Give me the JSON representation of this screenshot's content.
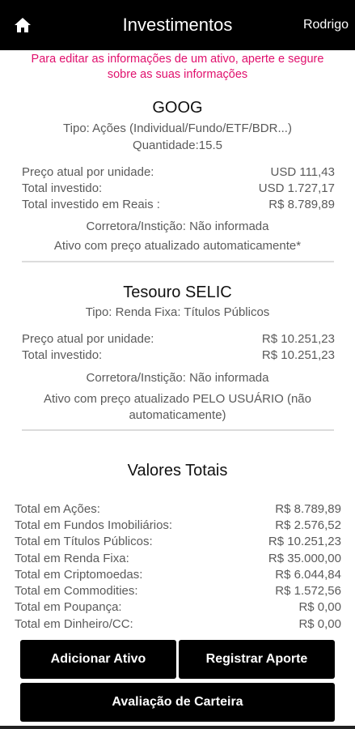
{
  "appbar": {
    "title": "Investimentos",
    "user": "Rodrigo",
    "home_icon": "home-icon"
  },
  "hint": {
    "line1": "Para editar as informações de um ativo, aperte e segure",
    "line2": "sobre as suas informações"
  },
  "assets": [
    {
      "name": "GOOG",
      "type": "Tipo: Ações (Individual/Fundo/ETF/BDR...)",
      "quantity": "Quantidade:15.5",
      "rows": [
        {
          "label": "Preço atual por unidade:",
          "value": "USD  111,43"
        },
        {
          "label": "Total investido:",
          "value": "USD  1.727,17"
        },
        {
          "label": "Total investido em Reais :",
          "value": "R$  8.789,89"
        }
      ],
      "broker": "Corretora/Instição: Não informada",
      "price_mode": "Ativo com preço atualizado automaticamente*"
    },
    {
      "name": "Tesouro SELIC",
      "type": "Tipo: Renda Fixa: Títulos Públicos",
      "rows": [
        {
          "label": "Preço atual por unidade:",
          "value": "R$  10.251,23"
        },
        {
          "label": "Total investido:",
          "value": "R$  10.251,23"
        }
      ],
      "broker": "Corretora/Instição: Não informada",
      "price_mode_line1": "Ativo com preço atualizado PELO USUÁRIO (não",
      "price_mode_line2": "automaticamente)"
    }
  ],
  "totals": {
    "title": "Valores Totais",
    "rows": [
      {
        "label": "Total em Ações:",
        "value": "R$  8.789,89"
      },
      {
        "label": "Total em Fundos Imobiliários:",
        "value": "R$  2.576,52"
      },
      {
        "label": "Total em Títulos Públicos:",
        "value": "R$  10.251,23"
      },
      {
        "label": "Total em Renda Fixa:",
        "value": "R$  35.000,00"
      },
      {
        "label": "Total em Criptomoedas:",
        "value": "R$  6.044,84"
      },
      {
        "label": "Total em Commodities:",
        "value": "R$  1.572,56"
      },
      {
        "label": "Total em Poupança:",
        "value": "R$  0,00"
      },
      {
        "label": "Total em Dinheiro/CC:",
        "value": "R$  0,00"
      }
    ]
  },
  "buttons": {
    "add_asset": "Adicionar Ativo",
    "register_contribution": "Registrar Aporte",
    "portfolio_evaluation": "Avaliação de Carteira"
  }
}
